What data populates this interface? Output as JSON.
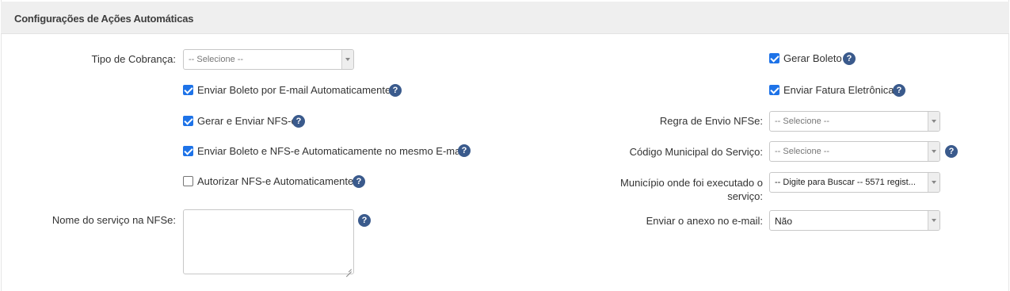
{
  "panel": {
    "title": "Configurações de Ações Automáticas"
  },
  "left": {
    "tipo_cobranca": {
      "label": "Tipo de Cobrança:",
      "value": "-- Selecione --"
    },
    "checkboxes": [
      {
        "label": "Enviar Boleto por E-mail Automaticamente",
        "checked": true,
        "help": true
      },
      {
        "label": "Gerar e Enviar NFS-e",
        "checked": true,
        "help": true
      },
      {
        "label": "Enviar Boleto e NFS-e Automaticamente no mesmo E-mail",
        "checked": true,
        "help": true
      },
      {
        "label": "Autorizar NFS-e Automaticamente",
        "checked": false,
        "help": true
      }
    ],
    "nome_servico": {
      "label": "Nome do serviço na NFSe:",
      "value": ""
    }
  },
  "right": {
    "checkboxes": [
      {
        "label": "Gerar Boleto",
        "checked": true
      },
      {
        "label": "Enviar Fatura Eletrônica",
        "checked": true
      }
    ],
    "regra_envio": {
      "label": "Regra de Envio NFSe:",
      "value": "-- Selecione --"
    },
    "codigo_municipal": {
      "label": "Código Municipal do Serviço:",
      "value": "-- Selecione --"
    },
    "municipio": {
      "label_line1": "Município onde foi executado o",
      "label_line2": "serviço:",
      "value": "-- Digite para Buscar -- 5571 regist..."
    },
    "anexo": {
      "label": "Enviar o anexo no e-mail:",
      "value": "Não"
    }
  },
  "icons": {
    "help": "question-circle-icon",
    "dropdown": "caret-down-icon",
    "checkbox": "check-icon"
  },
  "colors": {
    "checkbox": "#1e73e8",
    "help_icon": "#3a5a8c",
    "header_bg": "#efefef"
  },
  "help_glyph": "?"
}
